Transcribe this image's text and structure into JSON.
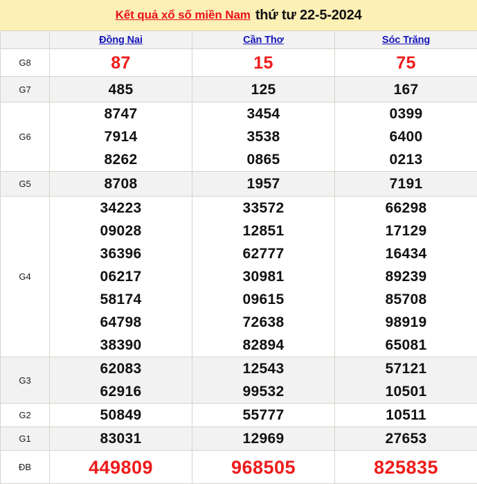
{
  "banner": {
    "link_text": "Kết quả xổ số miền Nam",
    "date_text": "thứ tư 22-5-2024",
    "background": "#fdf0b5",
    "link_color": "#e8111a"
  },
  "table": {
    "corner_label": "",
    "provinces": [
      {
        "name": "Đồng Nai"
      },
      {
        "name": "Cần Thơ"
      },
      {
        "name": "Sóc Trăng"
      }
    ],
    "province_link_color": "#1414b8",
    "highlight_color": "#ee1b1b",
    "rows": [
      {
        "label": "G8",
        "style": "g8",
        "values": [
          [
            "87"
          ],
          [
            "15"
          ],
          [
            "75"
          ]
        ]
      },
      {
        "label": "G7",
        "style": "normal",
        "values": [
          [
            "485"
          ],
          [
            "125"
          ],
          [
            "167"
          ]
        ]
      },
      {
        "label": "G6",
        "style": "normal",
        "values": [
          [
            "8747",
            "7914",
            "8262"
          ],
          [
            "3454",
            "3538",
            "0865"
          ],
          [
            "0399",
            "6400",
            "0213"
          ]
        ]
      },
      {
        "label": "G5",
        "style": "normal",
        "values": [
          [
            "8708"
          ],
          [
            "1957"
          ],
          [
            "7191"
          ]
        ]
      },
      {
        "label": "G4",
        "style": "normal",
        "values": [
          [
            "34223",
            "09028",
            "36396",
            "06217",
            "58174",
            "64798",
            "38390"
          ],
          [
            "33572",
            "12851",
            "62777",
            "30981",
            "09615",
            "72638",
            "82894"
          ],
          [
            "66298",
            "17129",
            "16434",
            "89239",
            "85708",
            "98919",
            "65081"
          ]
        ]
      },
      {
        "label": "G3",
        "style": "normal",
        "values": [
          [
            "62083",
            "62916"
          ],
          [
            "12543",
            "99532"
          ],
          [
            "57121",
            "10501"
          ]
        ]
      },
      {
        "label": "G2",
        "style": "normal",
        "values": [
          [
            "50849"
          ],
          [
            "55777"
          ],
          [
            "10511"
          ]
        ]
      },
      {
        "label": "G1",
        "style": "normal",
        "values": [
          [
            "83031"
          ],
          [
            "12969"
          ],
          [
            "27653"
          ]
        ]
      },
      {
        "label": "ĐB",
        "style": "db",
        "values": [
          [
            "449809"
          ],
          [
            "968505"
          ],
          [
            "825835"
          ]
        ]
      }
    ]
  }
}
